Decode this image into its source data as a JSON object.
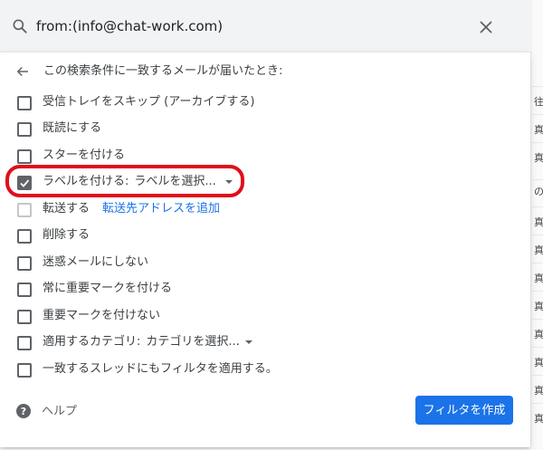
{
  "search": {
    "query": "from:(info@chat-work.com)"
  },
  "panel": {
    "header": "この検索条件に一致するメールが届いたとき:",
    "options": [
      {
        "label": "受信トレイをスキップ (アーカイブする)",
        "checked": false
      },
      {
        "label": "既読にする",
        "checked": false
      },
      {
        "label": "スターを付ける",
        "checked": false
      },
      {
        "label": "ラベルを付ける:",
        "checked": true,
        "select": "ラベルを選択..."
      },
      {
        "label": "転送する",
        "checked": false,
        "link": "転送先アドレスを追加"
      },
      {
        "label": "削除する",
        "checked": false
      },
      {
        "label": "迷惑メールにしない",
        "checked": false
      },
      {
        "label": "常に重要マークを付ける",
        "checked": false
      },
      {
        "label": "重要マークを付けない",
        "checked": false
      },
      {
        "label": "適用するカテゴリ:",
        "checked": false,
        "select": "カテゴリを選択..."
      },
      {
        "label": "一致するスレッドにもフィルタを適用する。",
        "checked": false
      }
    ],
    "help_label": "ヘルプ",
    "create_button": "フィルタを作成"
  },
  "background_fragments": [
    "往",
    "真",
    "真",
    "の",
    "真",
    "真",
    "真",
    "真",
    "真",
    "真",
    "真",
    "真"
  ],
  "colors": {
    "accent": "#1a73e8",
    "highlight": "#e00d1c"
  },
  "icons": [
    "search-icon",
    "close-icon",
    "arrow-back-icon",
    "check-icon",
    "dropdown-caret-icon",
    "help-icon"
  ]
}
